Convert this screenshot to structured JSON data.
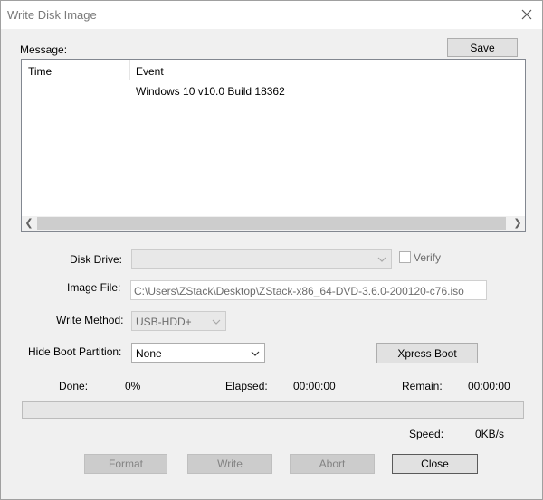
{
  "window": {
    "title": "Write Disk Image"
  },
  "message": {
    "label": "Message:",
    "save_label": "Save",
    "columns": [
      "Time",
      "Event"
    ],
    "rows": [
      {
        "time": "",
        "event": "Windows 10 v10.0 Build 18362"
      }
    ]
  },
  "form": {
    "disk_drive_label": "Disk Drive:",
    "disk_drive_value": "",
    "verify_label": "Verify",
    "image_file_label": "Image File:",
    "image_file_value": "C:\\Users\\ZStack\\Desktop\\ZStack-x86_64-DVD-3.6.0-200120-c76.iso",
    "write_method_label": "Write Method:",
    "write_method_value": "USB-HDD+",
    "hide_boot_label": "Hide Boot Partition:",
    "hide_boot_value": "None",
    "xpress_boot_label": "Xpress Boot"
  },
  "status": {
    "done_label": "Done:",
    "done_value": "0%",
    "elapsed_label": "Elapsed:",
    "elapsed_value": "00:00:00",
    "remain_label": "Remain:",
    "remain_value": "00:00:00",
    "speed_label": "Speed:",
    "speed_value": "0KB/s",
    "progress_fraction": 0
  },
  "buttons": {
    "format_label": "Format",
    "write_label": "Write",
    "abort_label": "Abort",
    "close_label": "Close"
  }
}
